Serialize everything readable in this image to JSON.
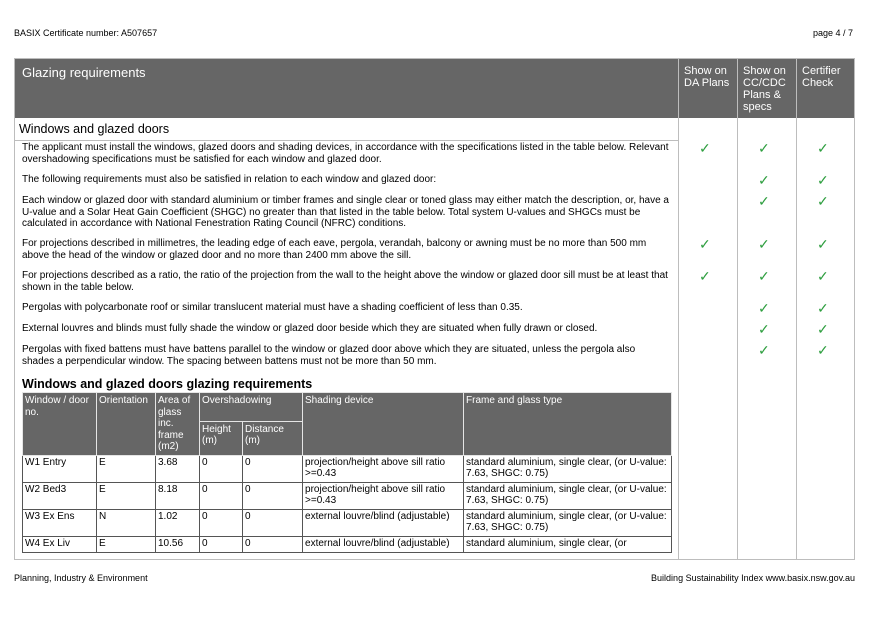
{
  "header": {
    "certificate": "BASIX Certificate number: A507657",
    "page": "page 4 / 7"
  },
  "panel": {
    "title": "Glazing requirements",
    "columns": [
      "Show on\nDA Plans",
      "Show on\nCC/CDC\nPlans &\nspecs",
      "Certifier\nCheck"
    ]
  },
  "section": {
    "title": "Windows and glazed doors",
    "requirements": [
      {
        "text": "The applicant must install the windows, glazed doors and shading devices, in accordance with the specifications listed in the table below. Relevant overshadowing specifications must be satisfied for each window and glazed door.",
        "da": true,
        "cc": true,
        "cert": true
      },
      {
        "text": "The following requirements must also be satisfied in relation to each window and glazed door:",
        "da": false,
        "cc": true,
        "cert": true
      },
      {
        "text": "Each window or glazed door with standard aluminium or timber frames and single clear or toned glass may either match the description, or, have a U-value and a Solar Heat Gain Coefficient (SHGC) no greater than that listed in the table below. Total system U-values and SHGCs must be calculated in accordance with National Fenestration Rating Council (NFRC) conditions.",
        "da": false,
        "cc": true,
        "cert": true
      },
      {
        "text": "For projections described in millimetres, the leading edge of each eave, pergola, verandah, balcony or awning must be no more than 500 mm above the head of the window or glazed door and no more than 2400 mm above the sill.",
        "da": true,
        "cc": true,
        "cert": true
      },
      {
        "text": "For projections described as a ratio, the ratio of the projection from the wall to the height above the window or glazed door sill must be at least that shown in the table below.",
        "da": true,
        "cc": true,
        "cert": true
      },
      {
        "text": "Pergolas with polycarbonate roof or similar translucent material must have a shading coefficient of less than 0.35.",
        "da": false,
        "cc": true,
        "cert": true
      },
      {
        "text": "External louvres and blinds must fully shade the window or glazed door beside which they are situated when fully drawn or closed.",
        "da": false,
        "cc": true,
        "cert": true
      },
      {
        "text": "Pergolas with fixed battens must have battens parallel to the window or glazed door above which they are situated, unless the pergola also shades a perpendicular window. The spacing between battens must not be more than 50 mm.",
        "da": false,
        "cc": true,
        "cert": true
      }
    ],
    "tick_symbol": "✓"
  },
  "glazing": {
    "title": "Windows and glazed doors glazing requirements",
    "headers": {
      "window": "Window / door no.",
      "orientation": "Orientation",
      "area": "Area of glass inc. frame (m2)",
      "overshadowing": "Overshadowing",
      "height": "Height (m)",
      "distance": "Distance (m)",
      "shading": "Shading device",
      "frame": "Frame and glass type"
    },
    "rows": [
      {
        "window": "W1 Entry",
        "orientation": "E",
        "area": "3.68",
        "height": "0",
        "distance": "0",
        "shading": "projection/height above sill ratio >=0.43",
        "frame": "standard aluminium, single clear, (or U-value: 7.63, SHGC: 0.75)"
      },
      {
        "window": "W2 Bed3",
        "orientation": "E",
        "area": "8.18",
        "height": "0",
        "distance": "0",
        "shading": "projection/height above sill ratio >=0.43",
        "frame": "standard aluminium, single clear, (or U-value: 7.63, SHGC: 0.75)"
      },
      {
        "window": "W3 Ex Ens",
        "orientation": "N",
        "area": "1.02",
        "height": "0",
        "distance": "0",
        "shading": "external louvre/blind (adjustable)",
        "frame": "standard aluminium, single clear, (or U-value: 7.63, SHGC: 0.75)"
      },
      {
        "window": "W4 Ex Liv",
        "orientation": "E",
        "area": "10.56",
        "height": "0",
        "distance": "0",
        "shading": "external louvre/blind (adjustable)",
        "frame": "standard aluminium, single clear, (or"
      }
    ]
  },
  "footer": {
    "left": "Planning, Industry & Environment",
    "right": "Building Sustainability Index www.basix.nsw.gov.au"
  },
  "colors": {
    "header_bg": "#666666",
    "tick": "#2e9e3f",
    "rule": "#bdbdbd"
  }
}
